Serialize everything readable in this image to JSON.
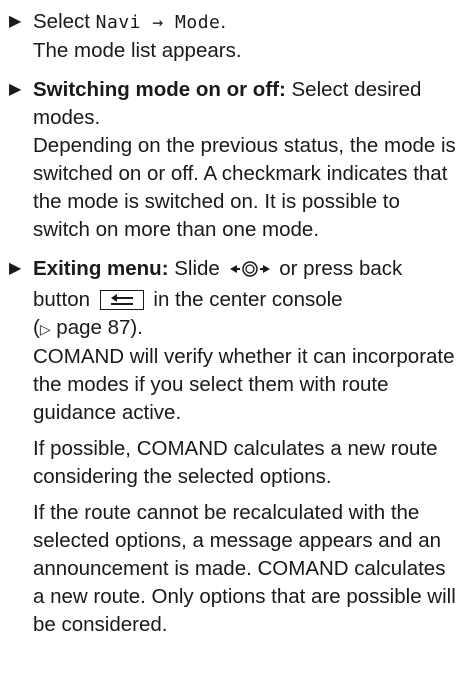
{
  "steps": [
    {
      "bullet": "▶",
      "prefix": "Select ",
      "menu_path": "Navi → Mode",
      "suffix": ".",
      "result": "The mode list appears."
    },
    {
      "bullet": "▶",
      "label": "Switching mode on or off:",
      "action": " Select desired modes.",
      "description": "Depending on the previous status, the mode is switched on or off. A checkmark indicates that the mode is switched on. It is possible to switch on more than one mode."
    },
    {
      "bullet": "▶",
      "label": "Exiting menu:",
      "action_part1": " Slide ",
      "controller_icon": "controller-slide-left-right-icon",
      "action_part2": " or press back button ",
      "back_icon": "back-button-icon",
      "action_part3": " in the center console",
      "page_ref_symbol": "▷",
      "page_ref": " page 87).",
      "page_ref_open": "(",
      "verify": "COMAND will verify whether it can incorporate the modes if you select them with route guidance active.",
      "possible": "If possible, COMAND calculates a new route considering the selected options.",
      "not_possible": "If the route cannot be recalculated with the selected options, a message appears and an announcement is made. COMAND calculates a new route. Only options that are possible will be considered."
    }
  ]
}
